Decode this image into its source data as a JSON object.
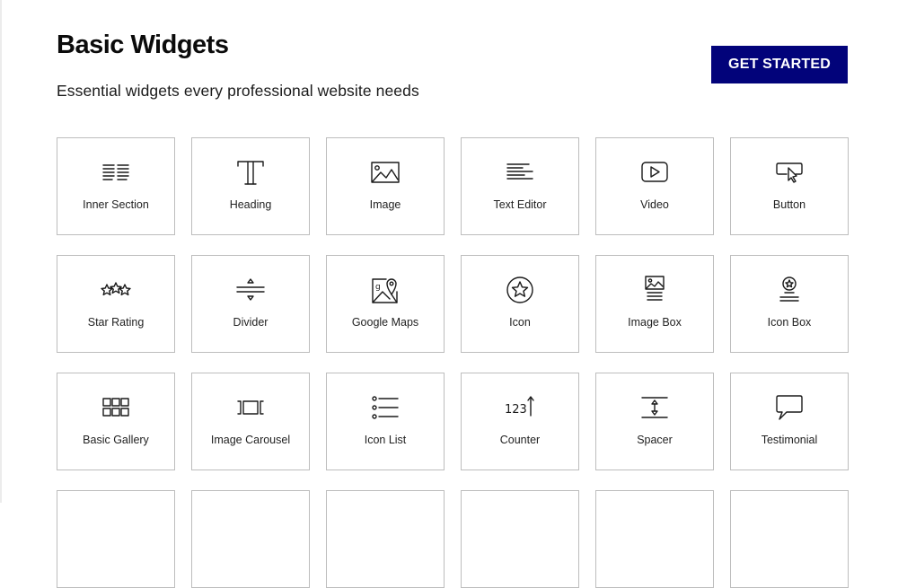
{
  "header": {
    "title": "Basic Widgets",
    "subtitle": "Essential widgets every professional website needs",
    "cta_label": "GET STARTED"
  },
  "colors": {
    "cta_background": "#02037a",
    "cta_text": "#ffffff",
    "card_border": "#bdbdbd"
  },
  "widgets": [
    {
      "label": "Inner Section",
      "icon": "inner-section-icon"
    },
    {
      "label": "Heading",
      "icon": "heading-icon"
    },
    {
      "label": "Image",
      "icon": "image-icon"
    },
    {
      "label": "Text Editor",
      "icon": "text-editor-icon"
    },
    {
      "label": "Video",
      "icon": "video-icon"
    },
    {
      "label": "Button",
      "icon": "button-icon"
    },
    {
      "label": "Star Rating",
      "icon": "star-rating-icon"
    },
    {
      "label": "Divider",
      "icon": "divider-icon"
    },
    {
      "label": "Google Maps",
      "icon": "google-maps-icon"
    },
    {
      "label": "Icon",
      "icon": "star-circle-icon"
    },
    {
      "label": "Image Box",
      "icon": "image-box-icon"
    },
    {
      "label": "Icon Box",
      "icon": "icon-box-icon"
    },
    {
      "label": "Basic Gallery",
      "icon": "gallery-icon"
    },
    {
      "label": "Image Carousel",
      "icon": "carousel-icon"
    },
    {
      "label": "Icon List",
      "icon": "icon-list-icon"
    },
    {
      "label": "Counter",
      "icon": "counter-icon"
    },
    {
      "label": "Spacer",
      "icon": "spacer-icon"
    },
    {
      "label": "Testimonial",
      "icon": "testimonial-icon"
    }
  ],
  "counter_icon_text": "123"
}
